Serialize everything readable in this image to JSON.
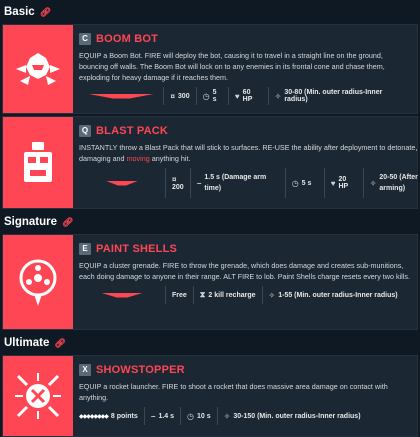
{
  "sections": {
    "basic": "Basic",
    "signature": "Signature",
    "ultimate": "Ultimate",
    "link_icon": "⊘"
  },
  "abilities": {
    "boom_bot": {
      "key": "C",
      "name": "BOOM BOT",
      "desc": "EQUIP a Boom Bot. FIRE will deploy the bot, causing it to travel in a straight line on the ground, bouncing off walls. The Boom Bot will lock on to any enemies in its frontal cone and chase them, exploding for heavy damage if it reaches them.",
      "stats": {
        "cost": "300",
        "time": "5 s",
        "hp": "60 HP",
        "damage": "30-80 (Min. outer radius-Inner radius)"
      }
    },
    "blast_pack": {
      "key": "Q",
      "name": "BLAST PACK",
      "desc_a": "INSTANTLY throw a Blast Pack that will stick to surfaces. RE-USE the ability after deployment to detonate, damaging and ",
      "desc_hl": "moving",
      "desc_b": " anything hit.",
      "stats": {
        "cost": "200",
        "arm": "1.5 s (Damage arm time)",
        "time": "5 s",
        "hp": "20 HP",
        "damage": "20-50 (After arming)"
      }
    },
    "paint_shells": {
      "key": "E",
      "name": "PAINT SHELLS",
      "desc": "EQUIP a cluster grenade. FIRE to throw the grenade, which does damage and creates sub-munitions, each doing damage to anyone in their range. ALT FIRE to lob. Paint Shells charge resets every two kills.",
      "stats": {
        "cost": "Free",
        "recharge": "2 kill recharge",
        "damage": "1-55 (Min. outer radius-Inner radius)"
      }
    },
    "showstopper": {
      "key": "X",
      "name": "SHOWSTOPPER",
      "desc": "EQUIP a rocket launcher. FIRE to shoot a rocket that does massive area damage on contact with anything.",
      "stats": {
        "points": "8 points",
        "windup": "1.4 s",
        "time": "10 s",
        "damage": "30-150 (Min. outer radius-Inner radius)"
      }
    }
  },
  "colors": {
    "accent": "#ff4655",
    "background": "#0f1923",
    "card": "#1b2733"
  }
}
